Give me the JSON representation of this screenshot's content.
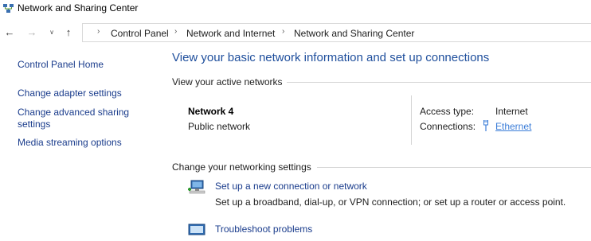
{
  "window": {
    "title": "Network and Sharing Center"
  },
  "address_bar": {
    "breadcrumbs": [
      "Control Panel",
      "Network and Internet",
      "Network and Sharing Center"
    ]
  },
  "sidebar": {
    "items": [
      {
        "label": "Control Panel Home"
      },
      {
        "label": "Change adapter settings"
      },
      {
        "label": "Change advanced sharing"
      },
      {
        "label": "settings"
      },
      {
        "label": "Media streaming options"
      }
    ]
  },
  "main": {
    "title": "View your basic network information and set up connections",
    "active_networks_header": "View your active networks",
    "network": {
      "name": "Network 4",
      "type": "Public network",
      "access_type_label": "Access type:",
      "access_type_value": "Internet",
      "connections_label": "Connections:",
      "connections_value": "Ethernet"
    },
    "settings_header": "Change your networking settings",
    "tasks": [
      {
        "link": "Set up a new connection or network",
        "description": "Set up a broadband, dial-up, or VPN connection; or set up a router or access point."
      },
      {
        "link": "Troubleshoot problems",
        "description": ""
      }
    ]
  },
  "icons": {
    "title": "network-sharing-icon",
    "back": "back-arrow-icon",
    "forward": "forward-arrow-icon",
    "recent": "chevron-down-icon",
    "up": "up-arrow-icon",
    "connection": "ethernet-icon",
    "task_new": "new-connection-icon",
    "task_troubleshoot": "troubleshoot-icon"
  },
  "colors": {
    "link": "#1a3c8c",
    "title": "#1e4e9c",
    "ethernet_link": "#3b7dd8"
  }
}
